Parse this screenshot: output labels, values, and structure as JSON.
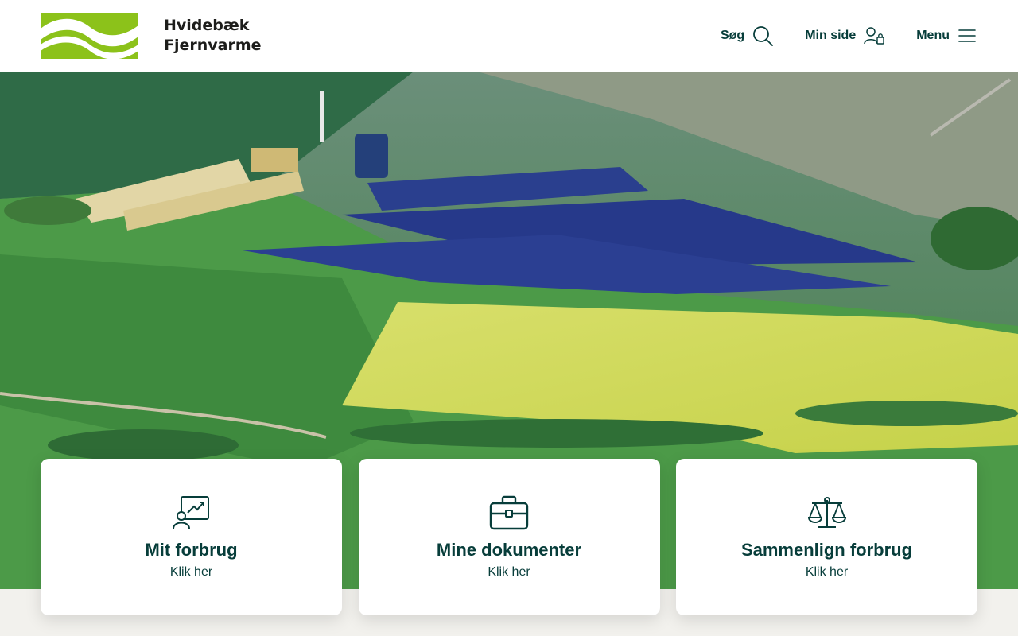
{
  "header": {
    "brand_line1": "Hvidebæk",
    "brand_line2": "Fjernvarme",
    "nav": {
      "search_label": "Søg",
      "my_page_label": "Min side",
      "menu_label": "Menu"
    }
  },
  "quick_links": [
    {
      "title": "Mit forbrug",
      "subtitle": "Klik her",
      "icon": "chart-screen-icon"
    },
    {
      "title": "Mine dokumenter",
      "subtitle": "Klik her",
      "icon": "briefcase-icon"
    },
    {
      "title": "Sammenlign forbrug",
      "subtitle": "Klik her",
      "icon": "scale-icon"
    }
  ],
  "colors": {
    "brand_green": "#8cc21a",
    "text_dark_green": "#073d3a",
    "background": "#f2f1ed"
  }
}
